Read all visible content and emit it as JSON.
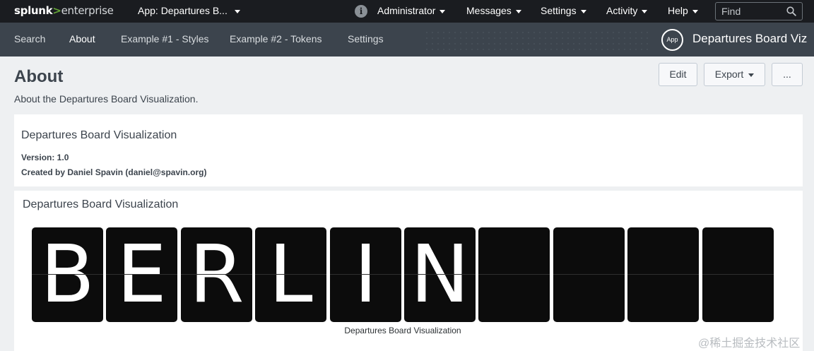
{
  "topbar": {
    "logo_brand": "splunk",
    "logo_gt": ">",
    "logo_product": "enterprise",
    "app_selector": "App: Departures B...",
    "info_glyph": "i",
    "menus": [
      {
        "label": "Administrator"
      },
      {
        "label": "Messages"
      },
      {
        "label": "Settings"
      },
      {
        "label": "Activity"
      },
      {
        "label": "Help"
      }
    ],
    "find_placeholder": "Find"
  },
  "appbar": {
    "nav": [
      {
        "label": "Search"
      },
      {
        "label": "About"
      },
      {
        "label": "Example #1 - Styles"
      },
      {
        "label": "Example #2 - Tokens"
      },
      {
        "label": "Settings"
      }
    ],
    "active_index": 1,
    "app_badge": "App",
    "app_title": "Departures Board Viz"
  },
  "page": {
    "title": "About",
    "description": "About the Departures Board Visualization.",
    "edit_label": "Edit",
    "export_label": "Export",
    "more_label": "..."
  },
  "panel1": {
    "title": "Departures Board Visualization",
    "version": "Version: 1.0",
    "created_prefix": "Created by Daniel Spavin (",
    "email": "daniel@spavin.org",
    "created_suffix": ")"
  },
  "panel2": {
    "title": "Departures Board Visualization",
    "board_chars": [
      "B",
      "E",
      "R",
      "L",
      "I",
      "N",
      "",
      "",
      "",
      ""
    ],
    "caption": "Departures Board Visualization"
  },
  "watermark": "@稀土掘金技术社区",
  "colors": {
    "topbar_bg": "#1a1c20",
    "appbar_bg": "#3c444d",
    "accent_green": "#65a637",
    "page_bg": "#eef0f2",
    "flap_bg": "#0c0c0c"
  }
}
